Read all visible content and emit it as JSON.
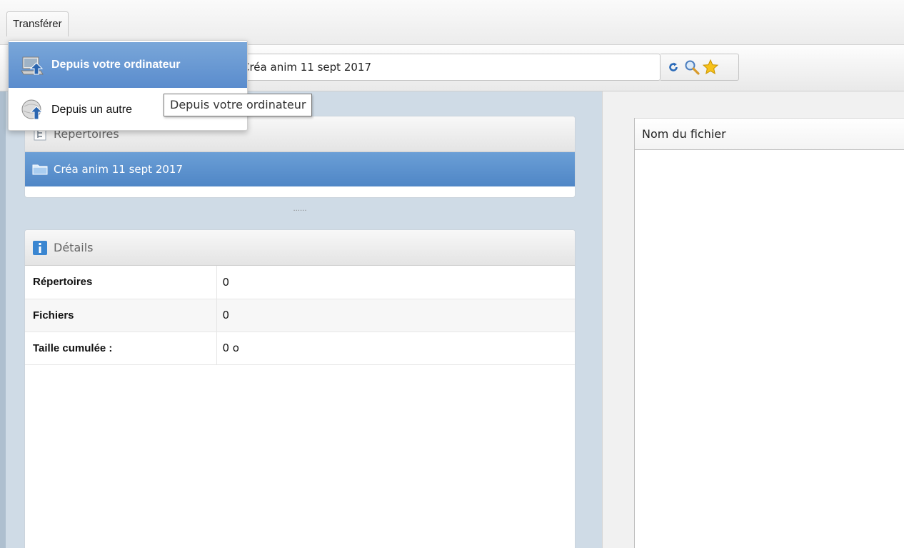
{
  "menubar": {
    "transferer_label": "Transférer"
  },
  "dropdown": {
    "items": [
      {
        "label": "Depuis votre ordinateur",
        "icon": "computer-upload-icon"
      },
      {
        "label": "Depuis un autre",
        "icon": "globe-upload-icon"
      }
    ]
  },
  "tooltip": {
    "text": "Depuis votre ordinateur"
  },
  "toolbar": {
    "path_value": "Créa anim 11 sept 2017",
    "buttons": [
      "refresh-icon",
      "search-icon",
      "favorite-star-icon"
    ]
  },
  "repertoires": {
    "title": "Répertoires",
    "selected_folder": "Créa anim 11 sept 2017"
  },
  "splitter": {
    "dots": "......"
  },
  "details": {
    "title": "Détails",
    "rows": [
      {
        "key": "Répertoires",
        "value": "0"
      },
      {
        "key": "Fichiers",
        "value": "0"
      },
      {
        "key": "Taille cumulée :",
        "value": "0 o"
      }
    ]
  },
  "file_list": {
    "column_header": "Nom du fichier"
  },
  "colors": {
    "selection_blue": "#5a8ccd",
    "left_pane_bg": "#cfdbe6",
    "star_yellow": "#f7c21b"
  }
}
